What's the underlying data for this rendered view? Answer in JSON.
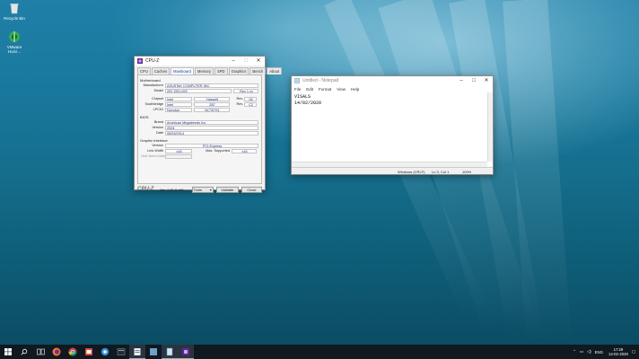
{
  "desktop": {
    "icons": [
      {
        "label": "Recycle Bin",
        "icon": "recycle-bin-icon"
      },
      {
        "label": "VMware Horiz...",
        "icon": "vmware-horizon-icon"
      }
    ]
  },
  "cpuz": {
    "title": "CPU-Z",
    "tabs": [
      "CPU",
      "Caches",
      "Mainboard",
      "Memory",
      "SPD",
      "Graphics",
      "Bench",
      "About"
    ],
    "active_tab": "Mainboard",
    "motherboard": {
      "group": "Motherboard",
      "manufacturer_label": "Manufacturer",
      "manufacturer": "ASUSTeK COMPUTER INC.",
      "model_label": "Model",
      "model": "Z87-DELUXE",
      "model_rev_label": "Rev 1.xx",
      "chipset_label": "Chipset",
      "chipset_vendor": "Intel",
      "chipset_name": "Haswell",
      "chipset_rev_label": "Rev.",
      "chipset_rev": "06",
      "southbridge_label": "Southbridge",
      "southbridge_vendor": "Intel",
      "southbridge_name": "Z87",
      "southbridge_rev_label": "Rev.",
      "southbridge_rev": "C2",
      "lpcio_label": "LPCIO",
      "lpcio_vendor": "Nuvoton",
      "lpcio_name": "NCT6791"
    },
    "bios": {
      "group": "BIOS",
      "brand_label": "Brand",
      "brand": "American Megatrends Inc.",
      "version_label": "Version",
      "version": "2004",
      "date_label": "Date",
      "date": "06/03/2014"
    },
    "graphic": {
      "group": "Graphic Interface",
      "version_label": "Version",
      "version": "PCI-Express",
      "link_width_label": "Link Width",
      "link_width": "x16",
      "max_supported_label": "Max. Supported",
      "max_supported": "x16",
      "side_band_label": "Side Band Addressing"
    },
    "footer": {
      "logo": "CPU-Z",
      "version": "Ver. 1.91.0.x64",
      "tools": "Tools",
      "validate": "Validate",
      "close": "Close"
    }
  },
  "notepad": {
    "title": "Untitled - Notepad",
    "menu": [
      "File",
      "Edit",
      "Format",
      "View",
      "Help"
    ],
    "lines": [
      "VISALS",
      "14/02/2020"
    ],
    "status": {
      "encoding": "Windows (CRLF)",
      "position": "Ln 3, Col 1",
      "zoom": "100%"
    }
  },
  "taskbar": {
    "apps": [
      "start-icon",
      "search-icon",
      "task-view-icon",
      "firefox-icon",
      "chrome-icon",
      "app-icon",
      "app-icon",
      "app-icon",
      "app-icon",
      "app-icon",
      "cpuz-icon"
    ],
    "tray": {
      "lang": "ENG",
      "time": "17:29",
      "date": "14-02-2020"
    }
  }
}
